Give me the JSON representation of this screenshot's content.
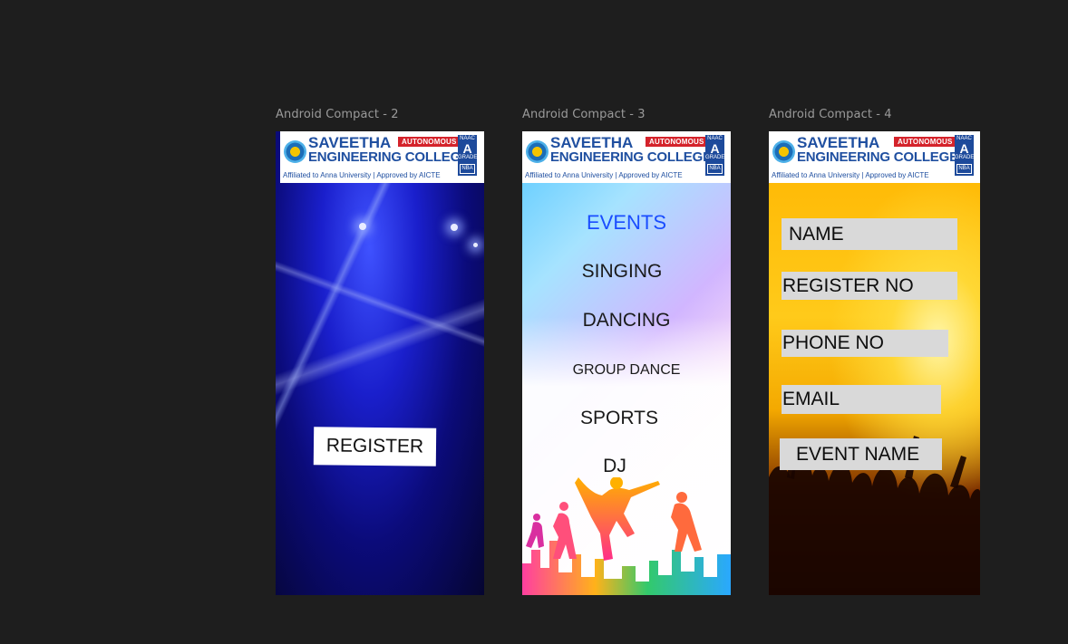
{
  "frames": [
    {
      "label": "Android Compact - 2"
    },
    {
      "label": "Android Compact - 3"
    },
    {
      "label": "Android Compact - 4"
    }
  ],
  "banner": {
    "line1": "SAVEETHA",
    "line2": "ENGINEERING COLLEGE",
    "affiliation": "Affiliated to Anna University | Approved by AICTE",
    "badge": "AUTONOMOUS",
    "naac_top": "NAAC",
    "naac_grade": "A",
    "naac_bottom": "GRADE",
    "nba": "NBA"
  },
  "screen2": {
    "register_label": "REGISTER"
  },
  "screen3": {
    "heading": "EVENTS",
    "items": [
      "SINGING",
      "DANCING",
      "GROUP DANCE",
      "SPORTS",
      "DJ"
    ],
    "heading_color": "#1a4dff"
  },
  "screen4": {
    "fields": [
      "NAME",
      "REGISTER NO",
      "PHONE NO",
      "EMAIL",
      "EVENT NAME"
    ]
  },
  "colors": {
    "canvas": "#1e1e1e",
    "brand_blue": "#1f4fa0",
    "badge_red": "#d4232b",
    "field_gray": "#d9d9d9"
  },
  "icons": [
    "college-seal-icon",
    "naac-grade-icon",
    "nba-logo-icon"
  ]
}
